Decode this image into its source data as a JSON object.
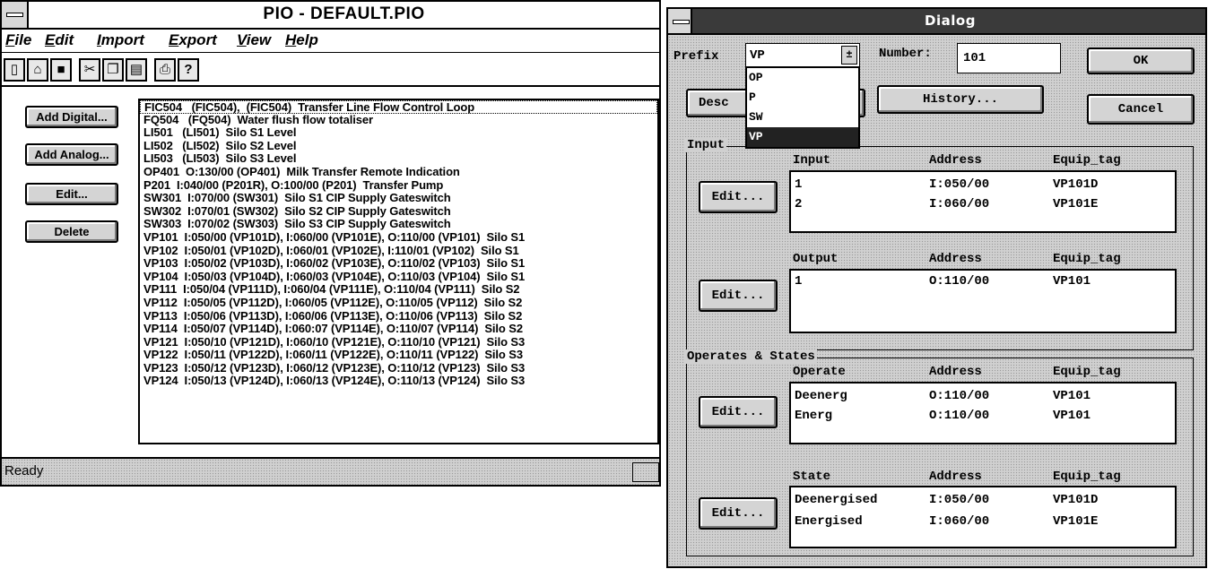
{
  "pio": {
    "title": "PIO - DEFAULT.PIO",
    "menu": [
      {
        "u": "F",
        "rest": "ile"
      },
      {
        "u": "E",
        "rest": "dit"
      },
      {
        "u": "I",
        "rest": "mport"
      },
      {
        "u": "E",
        "rest": "xport"
      },
      {
        "u": "V",
        "rest": "iew"
      },
      {
        "u": "H",
        "rest": "elp"
      }
    ],
    "toolbar_icons": [
      "new-file-icon",
      "open-folder-icon",
      "save-icon",
      "cut-icon",
      "copy-icon",
      "paste-icon",
      "print-icon",
      "help-icon"
    ],
    "buttons": {
      "add_digital": "Add Digital...",
      "add_analog": "Add Analog...",
      "edit": "Edit...",
      "delete": "Delete"
    },
    "list": [
      "FIC504   (FIC504),  (FIC504)  Transfer Line Flow Control Loop",
      "FQ504   (FQ504)  Water flush flow totaliser",
      "LI501   (LI501)  Silo S1 Level",
      "LI502   (LI502)  Silo S2 Level",
      "LI503   (LI503)  Silo S3 Level",
      "OP401  O:130/00 (OP401)  Milk Transfer Remote Indication",
      "P201  I:040/00 (P201R), O:100/00 (P201)  Transfer Pump",
      "SW301  I:070/00 (SW301)  Silo S1 CIP Supply Gateswitch",
      "SW302  I:070/01 (SW302)  Silo S2 CIP Supply Gateswitch",
      "SW303  I:070/02 (SW303)  Silo S3 CIP Supply Gateswitch",
      "VP101  I:050/00 (VP101D), I:060/00 (VP101E), O:110/00 (VP101)  Silo S1",
      "VP102  I:050/01 (VP102D), I:060/01 (VP102E), I:110/01 (VP102)  Silo S1",
      "VP103  I:050/02 (VP103D), I:060/02 (VP103E), O:110/02 (VP103)  Silo S1",
      "VP104  I:050/03 (VP104D), I:060/03 (VP104E), O:110/03 (VP104)  Silo S1",
      "VP111  I:050/04 (VP111D), I:060/04 (VP111E), O:110/04 (VP111)  Silo S2",
      "VP112  I:050/05 (VP112D), I:060/05 (VP112E), O:110/05 (VP112)  Silo S2",
      "VP113  I:050/06 (VP113D), I:060/06 (VP113E), O:110/06 (VP113)  Silo S2",
      "VP114  I:050/07 (VP114D), I:060:07 (VP114E), O:110/07 (VP114)  Silo S2",
      "VP121  I:050/10 (VP121D), I:060/10 (VP121E), O:110/10 (VP121)  Silo S3",
      "VP122  I:050/11 (VP122D), I:060/11 (VP122E), O:110/11 (VP122)  Silo S3",
      "VP123  I:050/12 (VP123D), I:060/12 (VP123E), O:110/12 (VP123)  Silo S3",
      "VP124  I:050/13 (VP124D), I:060/13 (VP124E), O:110/13 (VP124)  Silo S3"
    ],
    "status": "Ready"
  },
  "dialog": {
    "title": "Dialog",
    "prefix_label": "Prefix",
    "prefix_value": "VP",
    "prefix_options": [
      "OP",
      "P",
      "SW",
      "VP"
    ],
    "number_label": "Number:",
    "number_value": "101",
    "ok": "OK",
    "cancel": "Cancel",
    "desc": "Desc",
    "history": "History...",
    "edit": "Edit...",
    "inputs": {
      "group_title": "Input",
      "headers": [
        "Input",
        "Address",
        "Equip_tag"
      ],
      "rows": [
        [
          "1",
          "I:050/00",
          "VP101D"
        ],
        [
          "2",
          "I:060/00",
          "VP101E"
        ]
      ]
    },
    "outputs": {
      "headers": [
        "Output",
        "Address",
        "Equip_tag"
      ],
      "rows": [
        [
          "1",
          "O:110/00",
          "VP101"
        ]
      ]
    },
    "operates_states": {
      "group_title": "Operates & States",
      "operate_headers": [
        "Operate",
        "Address",
        "Equip_tag"
      ],
      "operate_rows": [
        [
          "Deenerg",
          "O:110/00",
          "VP101"
        ],
        [
          "Energ",
          "O:110/00",
          "VP101"
        ]
      ],
      "state_headers": [
        "State",
        "Address",
        "Equip_tag"
      ],
      "state_rows": [
        [
          "Deenergised",
          "I:050/00",
          "VP101D"
        ],
        [
          "Energised",
          "I:060/00",
          "VP101E"
        ]
      ]
    }
  }
}
